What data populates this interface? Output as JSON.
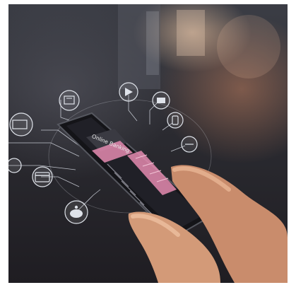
{
  "screen": {
    "title": "Online Banking"
  },
  "icons": [
    "money-icon",
    "bank-icon",
    "video-icon",
    "phone-icon",
    "card-icon",
    "piggy-bank-icon",
    "wallet-icon",
    "mobile-transfer-icon"
  ],
  "colors": {
    "accent_pink": "#e58bb0",
    "network_lines": "#d9dde6",
    "skin": "#d39a78"
  }
}
